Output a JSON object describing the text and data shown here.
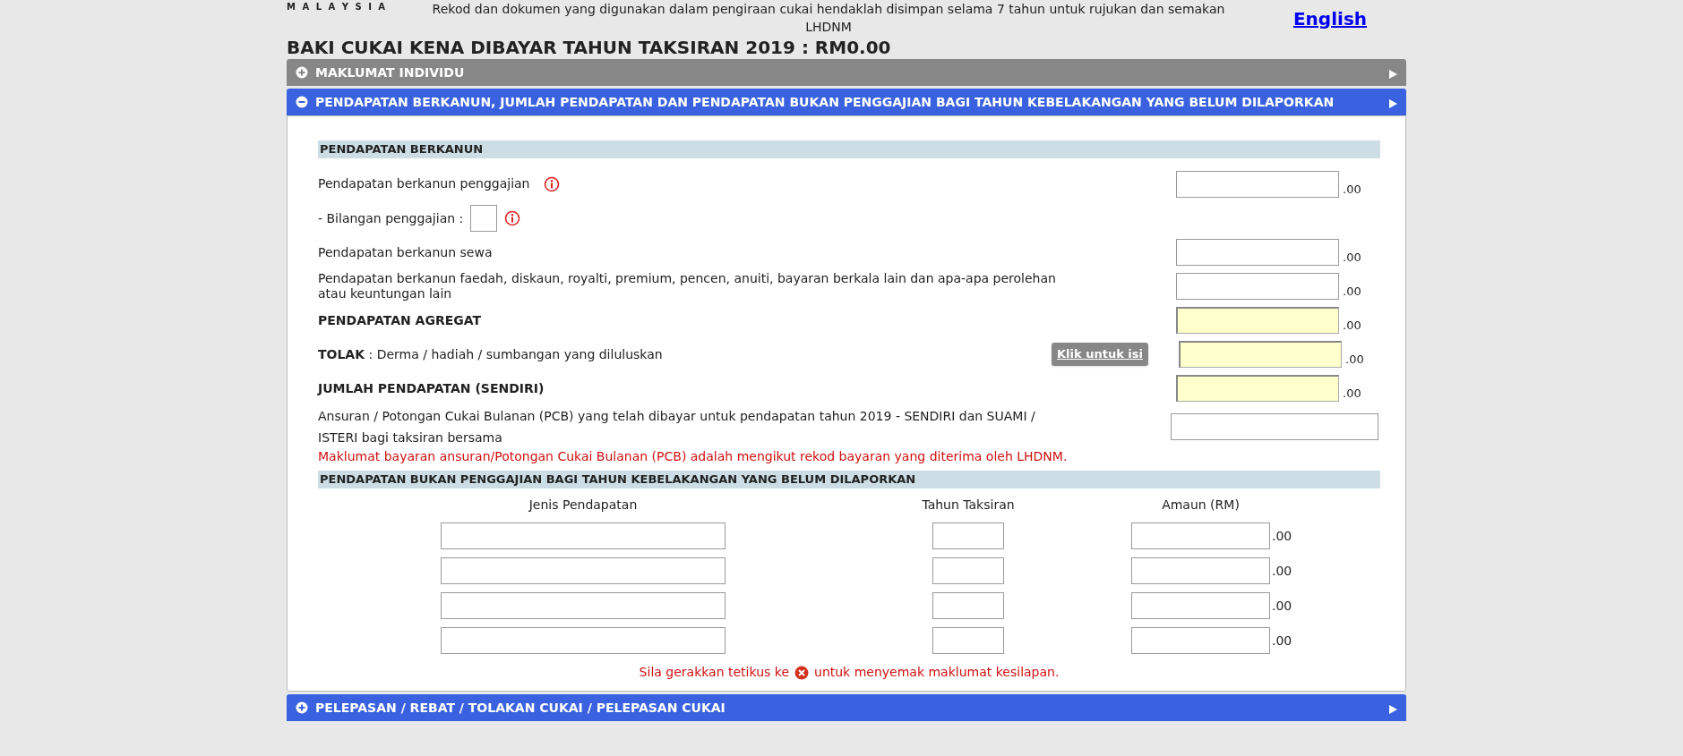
{
  "header": {
    "logo_text": "M A L A Y S I A",
    "notice": "Rekod dan dokumen yang digunakan dalam pengiraan cukai hendaklah disimpan selama 7 tahun untuk rujukan dan semakan LHDNM",
    "language_link": "English"
  },
  "title": "BAKI CUKAI KENA DIBAYAR TAHUN TAKSIRAN 2019 : RM0.00",
  "sections": [
    {
      "title": "MAKLUMAT INDIVIDU",
      "expanded": false,
      "color": "#878787"
    },
    {
      "title": "PENDAPATAN BERKANUN, JUMLAH PENDAPATAN DAN PENDAPATAN BUKAN PENGGAJIAN BAGI TAHUN KEBELAKANGAN YANG BELUM DILAPORKAN",
      "expanded": true,
      "color": "#3a62e0",
      "content": {
        "subsection_1": "PENDAPATAN BERKANUN",
        "rows": [
          {
            "kind": "amount",
            "label": "Pendapatan berkanun penggajian",
            "bold": false,
            "info": true,
            "suffix": ".00"
          },
          {
            "kind": "count",
            "label": "- Bilangan penggajian :",
            "bold": false,
            "info": true
          },
          {
            "kind": "amount",
            "label": "Pendapatan berkanun sewa",
            "bold": false,
            "info": false,
            "suffix": ".00"
          },
          {
            "kind": "amount",
            "label": "Pendapatan berkanun faedah, diskaun, royalti, premium, pencen, anuiti, bayaran berkala lain dan apa-apa perolehan atau keuntungan lain",
            "bold": false,
            "info": false,
            "suffix": ".00"
          },
          {
            "kind": "computed",
            "label": "PENDAPATAN AGREGAT",
            "bold": true,
            "info": false,
            "suffix": ".00"
          },
          {
            "kind": "computed",
            "label": "**TOLAK** : Derma / hadiah / sumbangan yang diluluskan",
            "bold": false,
            "info": false,
            "button": "Klik untuk isi",
            "suffix": ".00"
          },
          {
            "kind": "computed",
            "label": "JUMLAH PENDAPATAN (SENDIRI)",
            "bold": true,
            "info": false,
            "suffix": ".00"
          },
          {
            "kind": "plain",
            "label": "Ansuran / Potongan Cukai Bulanan (PCB) yang telah dibayar untuk pendapatan tahun 2019 - SENDIRI dan SUAMI / ISTERI bagi taksiran bersama",
            "bold": false,
            "note": "Maklumat bayaran ansuran/Potongan Cukai Bulanan (PCB) adalah mengikut rekod bayaran yang diterima oleh LHDNM."
          }
        ],
        "subsection_2": "PENDAPATAN BUKAN PENGGAJIAN BAGI TAHUN KEBELAKANGAN YANG BELUM DILAPORKAN",
        "table": {
          "columns": [
            "Jenis Pendapatan",
            "Tahun Taksiran",
            "Amaun (RM)"
          ],
          "rows": [
            {
              "suffix": ".00"
            },
            {
              "suffix": ".00"
            },
            {
              "suffix": ".00"
            },
            {
              "suffix": ".00"
            }
          ]
        },
        "error_hint": {
          "before": "Sila gerakkan tetikus ke",
          "after": "untuk menyemak maklumat kesilapan."
        }
      }
    },
    {
      "title": "PELEPASAN / REBAT / TOLAKAN CUKAI / PELEPASAN CUKAI",
      "expanded": false,
      "color": "#3a62e0"
    }
  ]
}
